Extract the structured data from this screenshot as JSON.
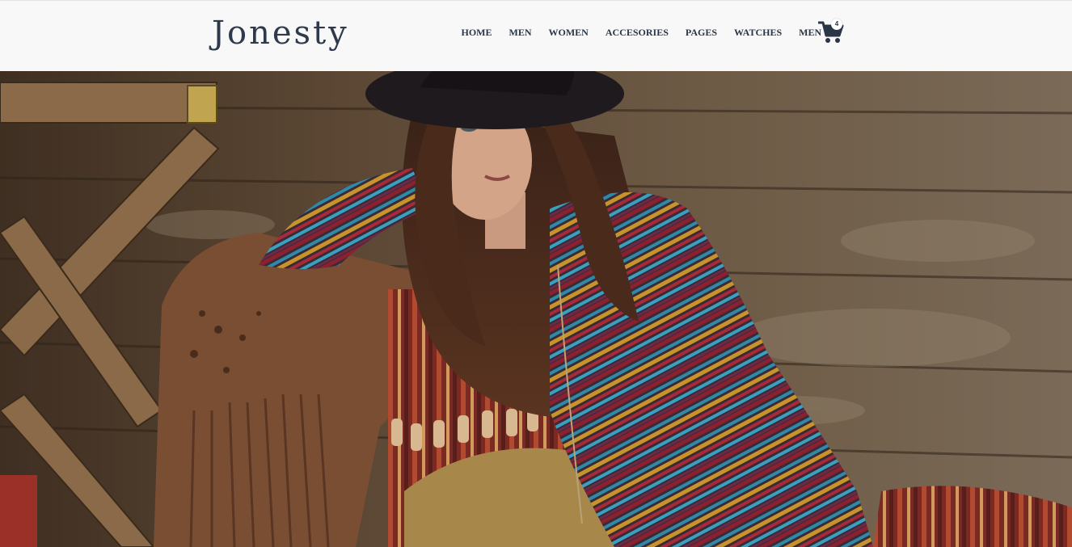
{
  "header": {
    "logo": "Jonesty",
    "nav": [
      "HOME",
      "MEN",
      "WOMEN",
      "ACCESORIES",
      "PAGES",
      "WATCHES",
      "MEN"
    ],
    "cart": {
      "icon": "cart-icon",
      "count": "4"
    }
  },
  "hero": {
    "image": "woman-in-hat-and-striped-sweater-photo"
  },
  "colors": {
    "header_bg": "#f8f8f8",
    "text": "#2a3547",
    "logo": "#2e3a4c"
  }
}
